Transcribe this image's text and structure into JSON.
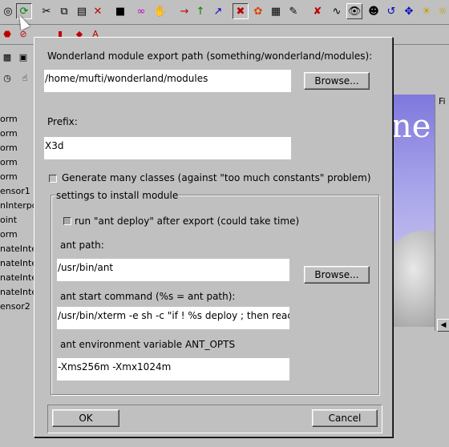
{
  "background": {
    "tree_items": [
      "orm",
      "orm",
      "orm",
      "orm",
      "orm",
      "ensor1",
      "nInterpo",
      "oint",
      "orm",
      "nateInte",
      "nateInte",
      "nateInte",
      "nateInte",
      "ensor2"
    ],
    "scene_text": "ne",
    "side_tab": "Fi"
  },
  "dialog": {
    "export_path_label": "Wonderland module export path (something/wonderland/modules):",
    "export_path_value": "/home/mufti/wonderland/modules",
    "browse_label": "Browse...",
    "prefix_label": "Prefix:",
    "prefix_value": "X3d",
    "many_classes_label": "Generate many classes (against \"too much constants\" problem)",
    "settings_group_title": "settings to install module",
    "run_ant_label": "run \"ant deploy\" after export (could take time)",
    "ant_path_label": "ant path:",
    "ant_path_value": "/usr/bin/ant",
    "ant_browse_label": "Browse...",
    "ant_start_label": "ant start command (%s = ant path):",
    "ant_start_value": "/usr/bin/xterm -e sh -c \"if ! %s deploy ; then read PA",
    "ant_env_label": "ant environment variable ANT_OPTS",
    "ant_env_value": "-Xms256m -Xmx1024m",
    "ok_label": "OK",
    "cancel_label": "Cancel"
  },
  "colors": {
    "window_bg": "#c0c0c0",
    "field_bg": "#ffffff",
    "scene_sky": "#7f78dd"
  }
}
